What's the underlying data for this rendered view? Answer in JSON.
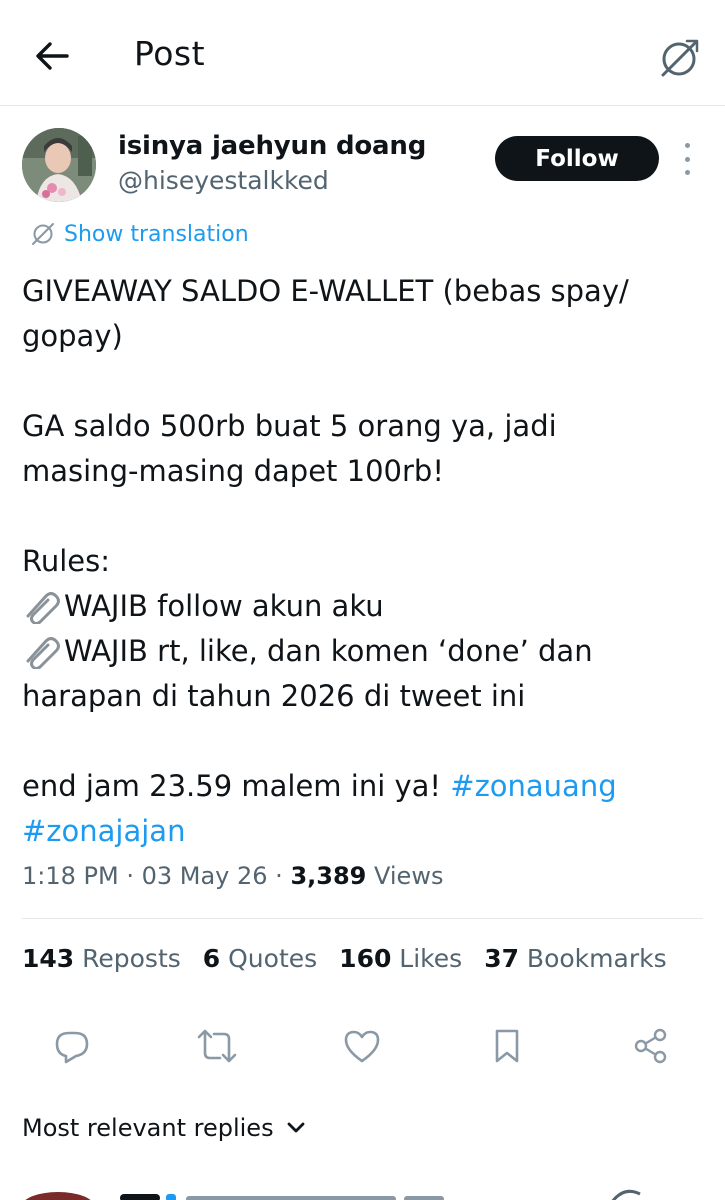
{
  "header": {
    "title": "Post"
  },
  "author": {
    "display_name": "isinya jaehyun doang",
    "handle": "@hiseyestalkked",
    "follow_label": "Follow"
  },
  "translation": {
    "label": "Show translation"
  },
  "tweet": {
    "line1": "GIVEAWAY SALDO E-WALLET (bebas spay/",
    "line2": "gopay)",
    "line3": "GA saldo 500rb buat 5 orang ya, jadi",
    "line4": "masing-masing dapet 100rb!",
    "line5": "Rules:",
    "rule1": "WAJIB follow akun aku",
    "rule2a": "WAJIB rt, like, dan komen ‘done’ dan",
    "rule2b": "harapan di tahun 2026 di tweet ini",
    "line_end": "end jam 23.59 malem ini ya! ",
    "hashtag1": "#zonauang",
    "hashtag2": "#zonajajan"
  },
  "meta": {
    "time": "1:18 PM",
    "sep": " · ",
    "date": "03 May 26",
    "views_count": "3,389",
    "views_label": " Views"
  },
  "stats": [
    {
      "count": "143",
      "label": " Reposts"
    },
    {
      "count": "6",
      "label": " Quotes"
    },
    {
      "count": "160",
      "label": " Likes"
    },
    {
      "count": "37",
      "label": " Bookmarks"
    }
  ],
  "replies": {
    "sort_label": "Most relevant replies"
  },
  "icons": {
    "back": "arrow-left-icon",
    "grok": "grok-icon",
    "more": "more-vertical-icon",
    "translate": "grok-icon",
    "reply": "reply-icon",
    "repost": "repost-icon",
    "like": "heart-icon",
    "bookmark": "bookmark-icon",
    "share": "share-icon",
    "clip": "paperclip-icon"
  },
  "colors": {
    "accent": "#1d9bf0",
    "text": "#0f1419",
    "muted": "#536471",
    "follow_bg": "#0f1419"
  }
}
